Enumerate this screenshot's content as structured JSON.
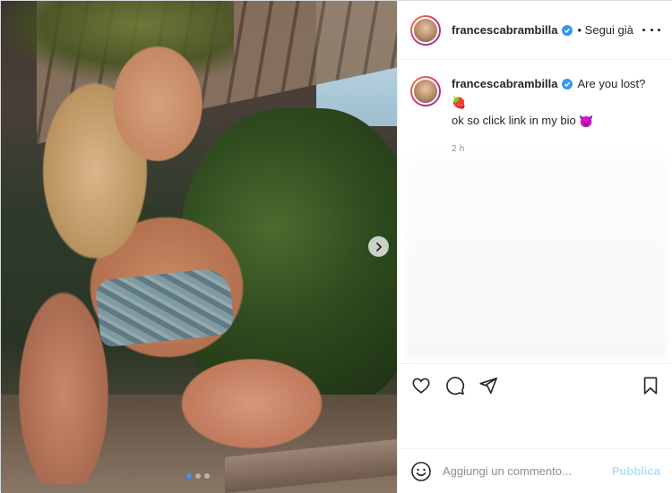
{
  "post": {
    "username": "francescabrambilla",
    "follow_status": "• Segui già",
    "carousel": {
      "slide_count": 3,
      "active_index": 0
    }
  },
  "caption": {
    "username": "francescabrambilla",
    "line1": "Are you lost?",
    "line2": "ok so click link in my bio",
    "emoji1": "🍓",
    "emoji2": "😈",
    "time": "2 h"
  },
  "comment_box": {
    "placeholder": "Aggiungi un commento...",
    "publish_label": "Pubblica"
  },
  "icons": {
    "header": [
      "verified-badge-icon",
      "more-options-icon"
    ],
    "actions": [
      "heart-icon",
      "comment-icon",
      "share-icon",
      "save-icon"
    ],
    "media": [
      "next-arrow-icon"
    ],
    "composer": [
      "emoji-icon"
    ]
  },
  "colors": {
    "accent": "#3897f0",
    "publish_disabled": "#b2dffc",
    "meta_text": "#8e8e8e",
    "text": "#262626"
  }
}
